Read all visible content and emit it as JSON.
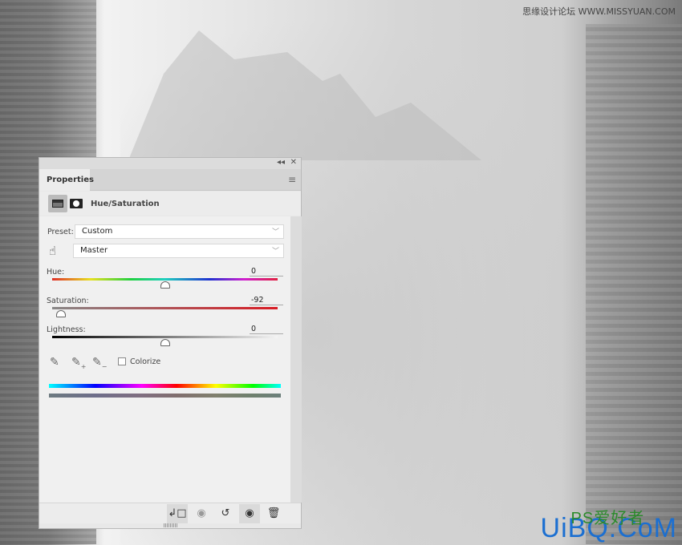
{
  "watermarks": {
    "top": "思缘设计论坛  WWW.MISSYUAN.COM",
    "bottom": "UiBQ.CoM",
    "bottom_overlay": "PS爱好者"
  },
  "panel": {
    "collapse_icon": "double-chevron-left",
    "close_icon": "close",
    "tab": "Properties",
    "menu_icon": "hamburger-menu",
    "adjustment_title": "Hue/Saturation",
    "preset_label": "Preset:",
    "preset_value": "Custom",
    "channel_value": "Master",
    "hue": {
      "label": "Hue:",
      "value": "0",
      "level": 0,
      "range": [
        -180,
        180
      ]
    },
    "saturation": {
      "label": "Saturation:",
      "value": "-92",
      "level": -92,
      "range": [
        -100,
        100
      ]
    },
    "lightness": {
      "label": "Lightness:",
      "value": "0",
      "level": 0,
      "range": [
        -100,
        100
      ]
    },
    "colorize_label": "Colorize",
    "colorize_checked": false,
    "toolbar": [
      "clip-to-layer",
      "view-previous-state",
      "reset",
      "toggle-visibility",
      "delete"
    ]
  }
}
